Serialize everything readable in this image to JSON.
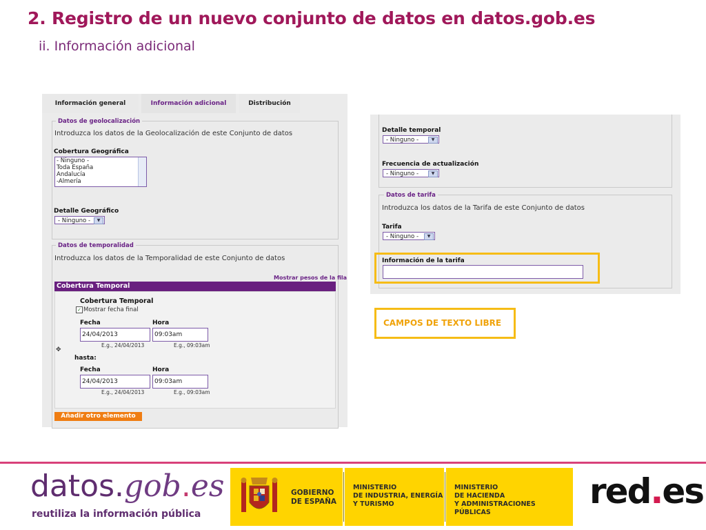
{
  "slide": {
    "title": "2. Registro de un nuevo conjunto de datos en datos.gob.es",
    "subtitle": "ii. Información adicional"
  },
  "tabs": [
    {
      "label": "Información general"
    },
    {
      "label": "Información adicional"
    },
    {
      "label": "Distribución"
    }
  ],
  "geolocalizacion": {
    "legend": "Datos de geolocalización",
    "intro": "Introduzca los datos de la Geolocalización de este Conjunto de datos",
    "cobertura_label": "Cobertura Geográfica",
    "cobertura_options": [
      "- Ninguno -",
      "Toda España",
      "Andalucía",
      "-Almería"
    ],
    "detalle_label": "Detalle Geográfico",
    "detalle_value": "- Ninguno -"
  },
  "temporalidad": {
    "legend": "Datos de temporalidad",
    "intro": "Introduzca los datos de la Temporalidad de este Conjunto de datos",
    "link": "Mostrar pesos de la fila",
    "bar_title": "Cobertura Temporal",
    "inner_title": "Cobertura Temporal",
    "checkbox_label": "Mostrar fecha final",
    "fecha_label": "Fecha",
    "hora_label": "Hora",
    "fecha_start": "24/04/2013",
    "hora_start": "09:03am",
    "fecha_hint": "E.g., 24/04/2013",
    "hora_hint": "E.g., 09:03am",
    "hasta_label": "hasta:",
    "fecha_end": "24/04/2013",
    "hora_end": "09:03am",
    "add_button": "Añadir otro elemento"
  },
  "right_panel": {
    "detalle_temporal_label": "Detalle temporal",
    "detalle_temporal_value": "- Ninguno -",
    "frecuencia_label": "Frecuencia de actualización",
    "frecuencia_value": "- Ninguno -",
    "tarifa_legend": "Datos de tarifa",
    "tarifa_intro": "Introduzca los datos de la Tarifa de este Conjunto de datos",
    "tarifa_label": "Tarifa",
    "tarifa_value": "- Ninguno -",
    "info_tarifa_label": "Información de la tarifa",
    "info_tarifa_value": ""
  },
  "callout": {
    "text": "CAMPOS DE TEXTO LIBRE"
  },
  "footer": {
    "datos_part1": "datos.",
    "datos_part2": "gob",
    "datos_dot": ".",
    "datos_part3": "es",
    "tagline": "reutiliza la información pública",
    "gobierno": "GOBIERNO\nDE ESPAÑA",
    "ministerio1": "MINISTERIO\nDE INDUSTRIA, ENERGÍA\nY TURISMO",
    "ministerio2": "MINISTERIO\nDE HACIENDA\nY ADMINISTRACIONES PÚBLICAS",
    "red_part1": "red",
    "red_dot": ".",
    "red_part2": "es"
  },
  "colors": {
    "title": "#a0185a",
    "purple": "#6a2386",
    "highlight": "#f6bc16",
    "orange": "#ef7d12",
    "footer_yellow": "#ffd400"
  }
}
